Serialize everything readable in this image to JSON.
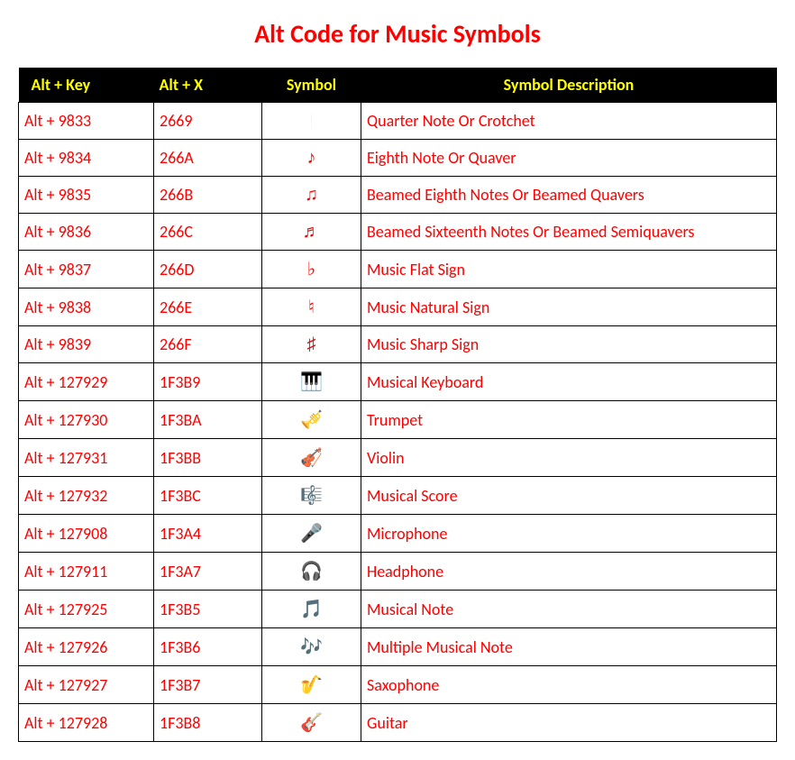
{
  "title": "Alt Code for Music Symbols",
  "headers": {
    "altkey": "Alt + Key",
    "altx": "Alt + X",
    "symbol": "Symbol",
    "desc": "Symbol Description"
  },
  "rows": [
    {
      "altkey": "Alt + 9833",
      "altx": "2669",
      "symbol": "♩",
      "desc": "Quarter Note Or Crotchet"
    },
    {
      "altkey": "Alt + 9834",
      "altx": "266A",
      "symbol": "♪",
      "desc": "Eighth Note Or Quaver"
    },
    {
      "altkey": "Alt + 9835",
      "altx": "266B",
      "symbol": "♫",
      "desc": "Beamed Eighth Notes Or Beamed Quavers"
    },
    {
      "altkey": "Alt + 9836",
      "altx": "266C",
      "symbol": "♬",
      "desc": "Beamed Sixteenth Notes Or Beamed Semiquavers"
    },
    {
      "altkey": "Alt + 9837",
      "altx": "266D",
      "symbol": "♭",
      "desc": "Music Flat Sign"
    },
    {
      "altkey": "Alt + 9838",
      "altx": "266E",
      "symbol": "♮",
      "desc": "Music Natural Sign"
    },
    {
      "altkey": "Alt + 9839",
      "altx": "266F",
      "symbol": "♯",
      "desc": "Music Sharp Sign"
    },
    {
      "altkey": "Alt + 127929",
      "altx": "1F3B9",
      "symbol": "🎹",
      "desc": "Musical Keyboard"
    },
    {
      "altkey": "Alt + 127930",
      "altx": "1F3BA",
      "symbol": "🎺",
      "desc": "Trumpet"
    },
    {
      "altkey": "Alt + 127931",
      "altx": "1F3BB",
      "symbol": "🎻",
      "desc": "Violin"
    },
    {
      "altkey": "Alt + 127932",
      "altx": "1F3BC",
      "symbol": "🎼",
      "desc": "Musical Score"
    },
    {
      "altkey": "Alt + 127908",
      "altx": "1F3A4",
      "symbol": "🎤",
      "desc": "Microphone"
    },
    {
      "altkey": "Alt + 127911",
      "altx": "1F3A7",
      "symbol": "🎧",
      "desc": "Headphone"
    },
    {
      "altkey": "Alt + 127925",
      "altx": "1F3B5",
      "symbol": "🎵",
      "desc": "Musical Note"
    },
    {
      "altkey": "Alt + 127926",
      "altx": "1F3B6",
      "symbol": "🎶",
      "desc": "Multiple Musical Note"
    },
    {
      "altkey": "Alt + 127927",
      "altx": "1F3B7",
      "symbol": "🎷",
      "desc": "Saxophone"
    },
    {
      "altkey": "Alt + 127928",
      "altx": "1F3B8",
      "symbol": "🎸",
      "desc": "Guitar"
    }
  ]
}
